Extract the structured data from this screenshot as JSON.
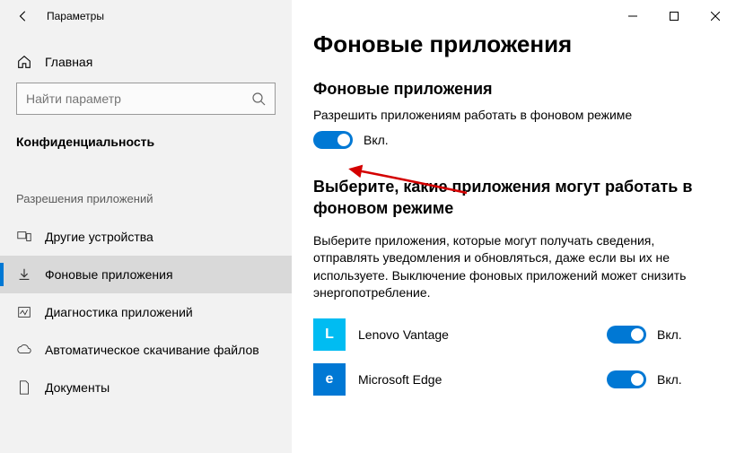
{
  "titlebar": {
    "title": "Параметры"
  },
  "sidebar": {
    "home": "Главная",
    "search_placeholder": "Найти параметр",
    "category": "Конфиденциальность",
    "subhead": "Разрешения приложений",
    "items": [
      {
        "label": "Другие устройства"
      },
      {
        "label": "Фоновые приложения"
      },
      {
        "label": "Диагностика приложений"
      },
      {
        "label": "Автоматическое скачивание файлов"
      },
      {
        "label": "Документы"
      }
    ]
  },
  "main": {
    "page_title": "Фоновые приложения",
    "section1_title": "Фоновые приложения",
    "section1_desc": "Разрешить приложениям работать в фоновом режиме",
    "toggle_on": "Вкл.",
    "section2_title": "Выберите, какие приложения могут работать в фоновом режиме",
    "section2_desc": "Выберите приложения, которые могут получать сведения, отправлять уведомления и обновляться, даже если вы их не используете. Выключение фоновых приложений может снизить энергопотребление.",
    "apps": [
      {
        "name": "Lenovo Vantage",
        "state": "Вкл.",
        "color": "#00bcf2",
        "letter": "L"
      },
      {
        "name": "Microsoft Edge",
        "state": "Вкл.",
        "color": "#0078d4",
        "letter": "e"
      }
    ]
  }
}
